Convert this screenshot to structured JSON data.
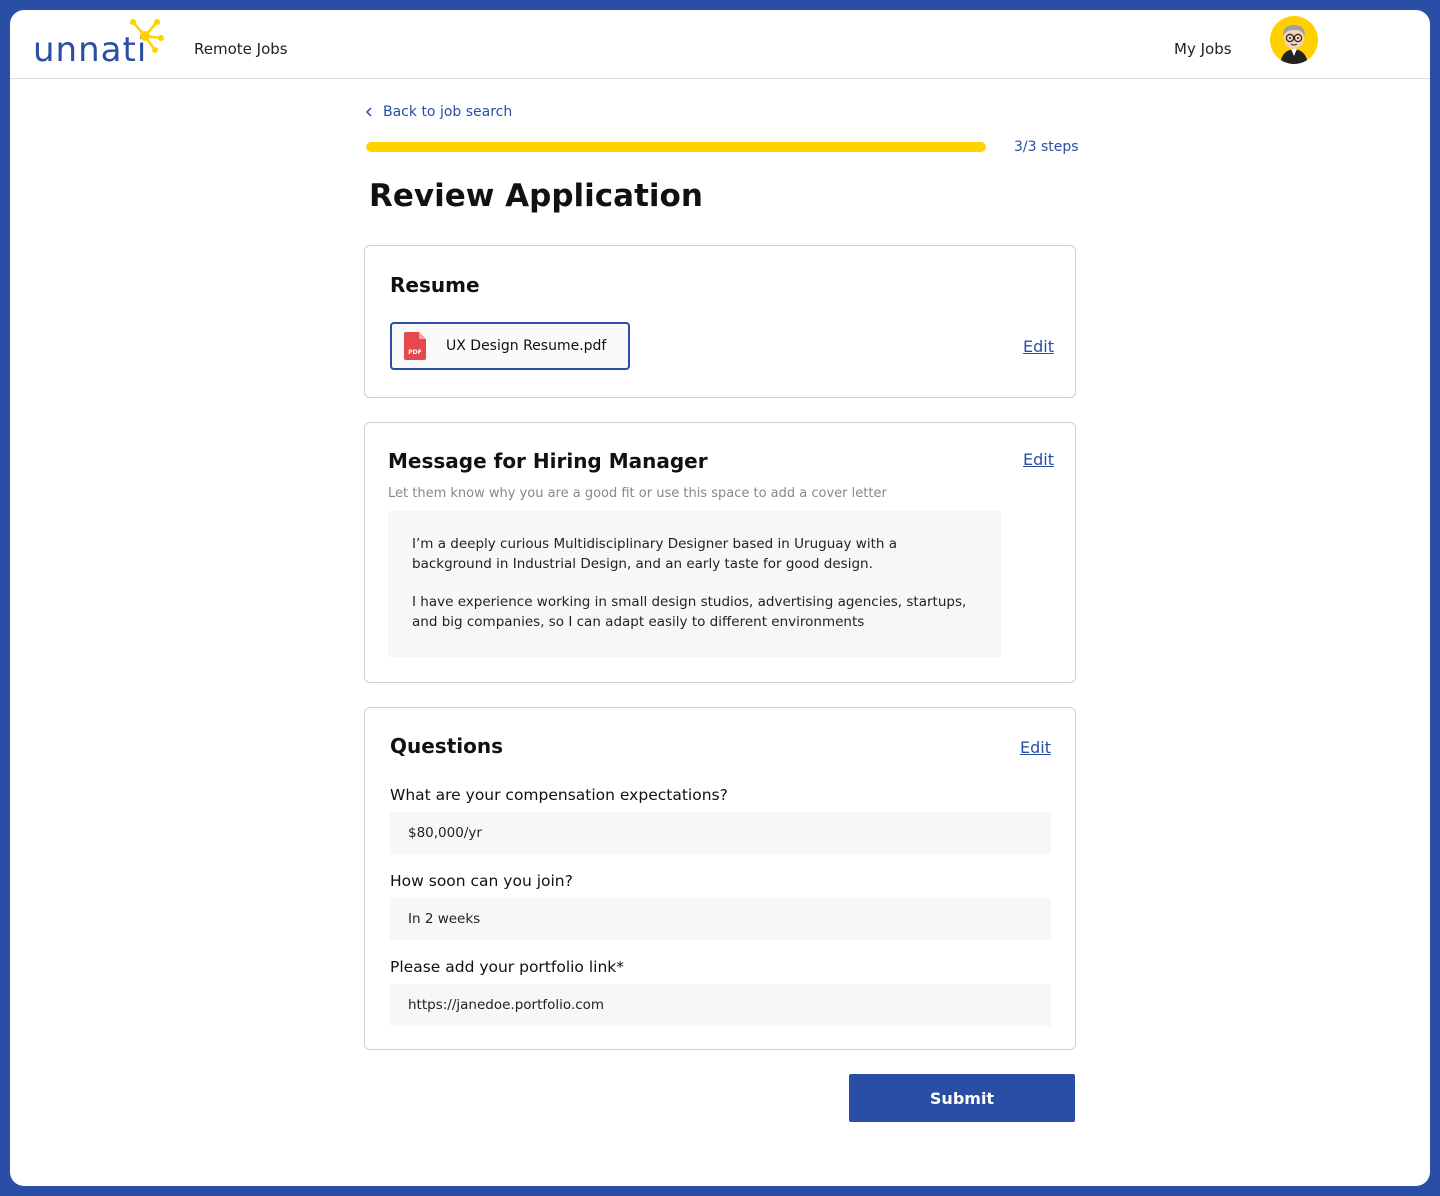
{
  "header": {
    "logo_text": "unnati",
    "nav_remote_jobs": "Remote Jobs",
    "nav_my_jobs": "My Jobs"
  },
  "nav": {
    "back_label": "Back to job search"
  },
  "progress": {
    "steps_label": "3/3 steps",
    "fraction": 1.0
  },
  "page_title": "Review Application",
  "resume": {
    "title": "Resume",
    "file_name": "UX Design Resume.pdf",
    "file_icon_label": "PDF",
    "edit_label": "Edit"
  },
  "message": {
    "title": "Message for Hiring Manager",
    "subtitle": "Let them know why you are a good fit or use this space to add a cover letter",
    "edit_label": "Edit",
    "paragraph_1": "I’m a deeply curious Multidisciplinary Designer based in Uruguay with a background in Industrial Design, and an early taste for good design.",
    "paragraph_2": "I have experience working in small design studios, advertising agencies, startups, and big companies, so I can adapt easily to different environments"
  },
  "questions": {
    "title": "Questions",
    "edit_label": "Edit",
    "items": [
      {
        "question": "What are your compensation expectations?",
        "answer": "$80,000/yr"
      },
      {
        "question": "How soon can you join?",
        "answer": "In 2 weeks"
      },
      {
        "question": "Please add your portfolio link*",
        "answer": "https://janedoe.portfolio.com"
      }
    ]
  },
  "submit_label": "Submit",
  "colors": {
    "brand_blue": "#2a4ea6",
    "accent_yellow": "#ffd200",
    "pdf_red": "#e5484d"
  }
}
